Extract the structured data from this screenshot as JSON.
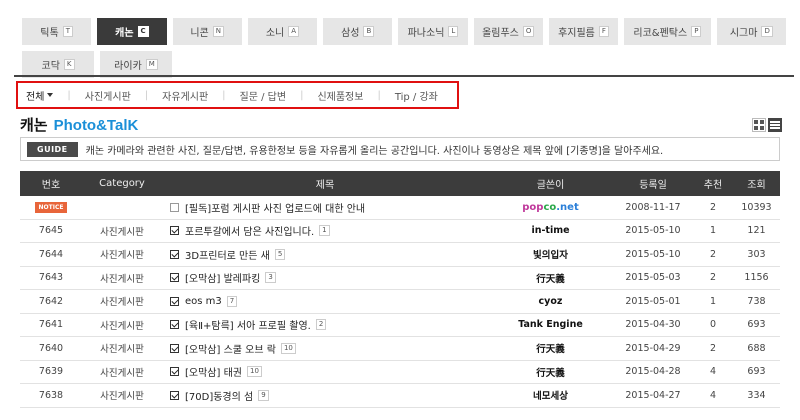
{
  "brand_tabs": [
    [
      {
        "label": "틱톡",
        "key": "T",
        "active": false
      },
      {
        "label": "캐논",
        "key": "C",
        "active": true
      },
      {
        "label": "니콘",
        "key": "N",
        "active": false
      },
      {
        "label": "소니",
        "key": "A",
        "active": false
      },
      {
        "label": "삼성",
        "key": "B",
        "active": false
      },
      {
        "label": "파나소닉",
        "key": "L",
        "active": false
      },
      {
        "label": "올림푸스",
        "key": "O",
        "active": false
      },
      {
        "label": "후지필름",
        "key": "F",
        "active": false
      },
      {
        "label": "리코&펜탁스",
        "key": "P",
        "active": false
      },
      {
        "label": "시그마",
        "key": "D",
        "active": false
      }
    ],
    [
      {
        "label": "코닥",
        "key": "K",
        "active": false
      },
      {
        "label": "라이카",
        "key": "M",
        "active": false
      }
    ]
  ],
  "categories": [
    "전체",
    "사진게시판",
    "자유게시판",
    "질문 / 답변",
    "신제품정보",
    "Tip / 강좌"
  ],
  "board": {
    "title": "캐논",
    "title_accent": "Photo&TalK"
  },
  "guide": {
    "badge": "GUIDE",
    "text": "캐논 카메라와 관련한 사진, 질문/답변, 유용한정보 등을 자유롭게 올리는 공간입니다. 사진이나 동영상은 제목 앞에 [기종명]을 달아주세요."
  },
  "table": {
    "headers": [
      "번호",
      "Category",
      "제목",
      "글쓴이",
      "등록일",
      "추천",
      "조회"
    ],
    "rows": [
      {
        "no": "NOTICE",
        "notice": true,
        "category": "",
        "title": "[필독]포럼 게시판 사진 업로드에 대한 안내",
        "checked": false,
        "comments": "",
        "author": "popco.net",
        "author_logo": true,
        "date": "2008-11-17",
        "rec": "2",
        "views": "10393"
      },
      {
        "no": "7645",
        "notice": false,
        "category": "사진게시판",
        "title": "포르투갈에서 담은 사진입니다.",
        "checked": true,
        "comments": "1",
        "author": "in-time",
        "author_logo": false,
        "date": "2015-05-10",
        "rec": "1",
        "views": "121"
      },
      {
        "no": "7644",
        "notice": false,
        "category": "사진게시판",
        "title": "3D프린터로 만든 새",
        "checked": true,
        "comments": "5",
        "author": "빛의입자",
        "author_logo": false,
        "date": "2015-05-10",
        "rec": "2",
        "views": "303"
      },
      {
        "no": "7643",
        "notice": false,
        "category": "사진게시판",
        "title": "[오막삼] 발레파킹",
        "checked": true,
        "comments": "3",
        "author": "行天義",
        "author_logo": false,
        "date": "2015-05-03",
        "rec": "2",
        "views": "1156"
      },
      {
        "no": "7642",
        "notice": false,
        "category": "사진게시판",
        "title": "eos m3",
        "checked": true,
        "comments": "7",
        "author": "cyoz",
        "author_logo": false,
        "date": "2015-05-01",
        "rec": "1",
        "views": "738"
      },
      {
        "no": "7641",
        "notice": false,
        "category": "사진게시판",
        "title": "[육Ⅱ+탐륵] 서아 프로필 촬영.",
        "checked": true,
        "comments": "2",
        "author": "Tank Engine",
        "author_logo": false,
        "date": "2015-04-30",
        "rec": "0",
        "views": "693"
      },
      {
        "no": "7640",
        "notice": false,
        "category": "사진게시판",
        "title": "[오막삼] 스쿨 오브 락",
        "checked": true,
        "comments": "10",
        "author": "行天義",
        "author_logo": false,
        "date": "2015-04-29",
        "rec": "2",
        "views": "688"
      },
      {
        "no": "7639",
        "notice": false,
        "category": "사진게시판",
        "title": "[오막삼] 태권",
        "checked": true,
        "comments": "10",
        "author": "行天義",
        "author_logo": false,
        "date": "2015-04-28",
        "rec": "4",
        "views": "693"
      },
      {
        "no": "7638",
        "notice": false,
        "category": "사진게시판",
        "title": "[70D]동경의 섬",
        "checked": true,
        "comments": "9",
        "author": "네모세상",
        "author_logo": false,
        "date": "2015-04-27",
        "rec": "4",
        "views": "334"
      }
    ]
  },
  "colors": {
    "accent": "#1a8fd8",
    "highlight_border": "#e01010",
    "notice": "#e8653a",
    "header_bg": "#3c3c3c"
  }
}
